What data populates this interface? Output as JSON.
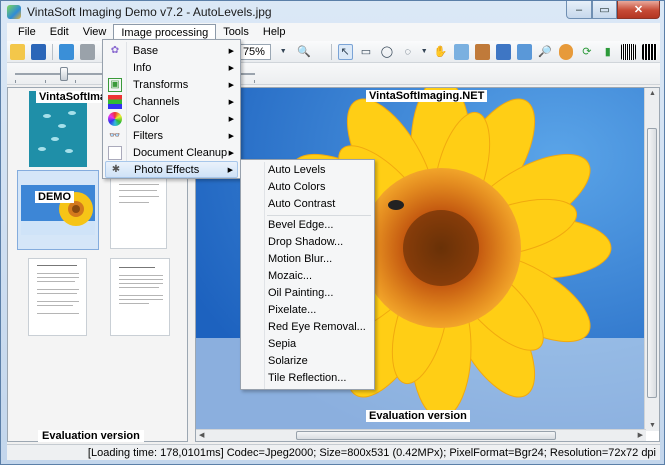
{
  "window": {
    "title": "VintaSoft Imaging Demo v7.2 - AutoLevels.jpg",
    "min_glyph": "–",
    "max_glyph": "▭",
    "close_glyph": "✕"
  },
  "menubar": {
    "items": [
      "File",
      "Edit",
      "View",
      "Image processing",
      "Tools",
      "Help"
    ]
  },
  "toolbar": {
    "zoom_value": "75%"
  },
  "thumbnails": {
    "watermark_top": "VintaSoftImaging.NET",
    "watermark_demo": "DEMO",
    "evaluation": "Evaluation version"
  },
  "viewer": {
    "watermark_top": "VintaSoftImaging.NET",
    "evaluation": "Evaluation version"
  },
  "image_processing_menu": {
    "items": [
      {
        "label": "Base",
        "icon": "base-icon",
        "submenu": true
      },
      {
        "label": "Info",
        "icon": "info-icon",
        "submenu": true
      },
      {
        "label": "Transforms",
        "icon": "transforms-icon",
        "submenu": true
      },
      {
        "label": "Channels",
        "icon": "channels-icon",
        "submenu": true
      },
      {
        "label": "Color",
        "icon": "color-icon",
        "submenu": true
      },
      {
        "label": "Filters",
        "icon": "filters-icon",
        "submenu": true
      },
      {
        "label": "Document Cleanup",
        "icon": "document-cleanup-icon",
        "submenu": true
      },
      {
        "label": "Photo Effects",
        "icon": "photo-effects-icon",
        "submenu": true
      }
    ],
    "highlighted": "Photo Effects"
  },
  "photo_effects_submenu": {
    "items": [
      "Auto Levels",
      "Auto Colors",
      "Auto Contrast",
      "Bevel Edge...",
      "Drop Shadow...",
      "Motion Blur...",
      "Mozaic...",
      "Oil Painting...",
      "Pixelate...",
      "Red Eye Removal...",
      "Sepia",
      "Solarize",
      "Tile Reflection..."
    ]
  },
  "statusbar": {
    "text": "[Loading time: 178,0101ms]  Codec=Jpeg2000; Size=800x531 (0.42MPx); PixelFormat=Bgr24; Resolution=72x72 dpi"
  },
  "colors": {
    "sky": "#2d7fd6",
    "petal": "#ffd21a",
    "center": "#e0781a",
    "selection": "#d5e6f8"
  }
}
